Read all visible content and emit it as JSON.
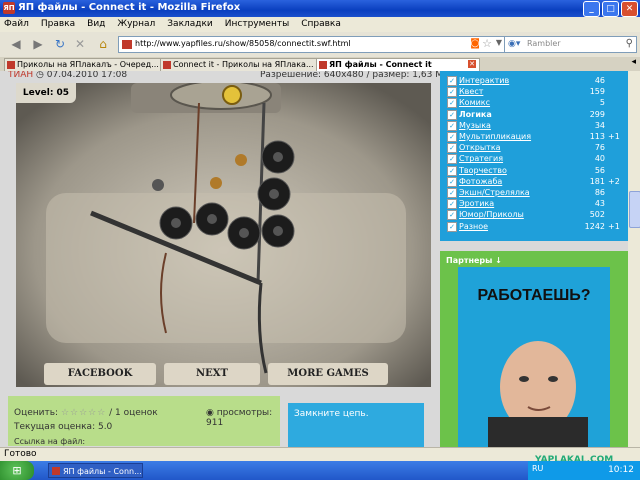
{
  "window": {
    "title": "ЯП файлы - Connect it - Mozilla Firefox"
  },
  "menu": [
    "Файл",
    "Правка",
    "Вид",
    "Журнал",
    "Закладки",
    "Инструменты",
    "Справка"
  ],
  "nav": {
    "url": "http://www.yapfiles.ru/show/85058/connectit.swf.html",
    "search_placeholder": "Rambler"
  },
  "tabs": [
    {
      "label": "Приколы на ЯПлакалъ - Очеред...",
      "active": false
    },
    {
      "label": "Connect it - Приколы на ЯПлака...",
      "active": false
    },
    {
      "label": "ЯП файлы - Connect it",
      "active": true
    }
  ],
  "info": {
    "author": "ТИАН",
    "date": "07.04.2010 17:08",
    "res": "Разрешение: 640x480 / размер: 1,63 Мб"
  },
  "game": {
    "level": "Level: 05",
    "buttons": [
      "FACEBOOK",
      "NEXT",
      "MORE GAMES"
    ]
  },
  "rating": {
    "label": "Оценить:",
    "stars": "☆☆☆☆☆",
    "count": "/ 1 оценок",
    "views": "просмотры: 911",
    "current": "Текущая оценка: 5.0",
    "links": "Ссылка на файл:"
  },
  "tip": "Замкните цепь.",
  "categories": [
    {
      "name": "Интерактив",
      "count": "46",
      "plus": "",
      "bold": false
    },
    {
      "name": "Квест",
      "count": "159",
      "plus": "",
      "bold": false
    },
    {
      "name": "Комикс",
      "count": "5",
      "plus": "",
      "bold": false
    },
    {
      "name": "Логика",
      "count": "299",
      "plus": "",
      "bold": true
    },
    {
      "name": "Музыка",
      "count": "34",
      "plus": "",
      "bold": false
    },
    {
      "name": "Мультипликация",
      "count": "113",
      "plus": "+1",
      "bold": false
    },
    {
      "name": "Открытка",
      "count": "76",
      "plus": "",
      "bold": false
    },
    {
      "name": "Стратегия",
      "count": "40",
      "plus": "",
      "bold": false
    },
    {
      "name": "Творчество",
      "count": "56",
      "plus": "",
      "bold": false
    },
    {
      "name": "Фотожаба",
      "count": "181",
      "plus": "+2",
      "bold": false
    },
    {
      "name": "Экшн/Стрелялка",
      "count": "86",
      "plus": "",
      "bold": false
    },
    {
      "name": "Эротика",
      "count": "43",
      "plus": "",
      "bold": false
    },
    {
      "name": "Юмор/Приколы",
      "count": "502",
      "plus": "",
      "bold": false
    },
    {
      "name": "Разное",
      "count": "1242",
      "plus": "+1",
      "bold": false
    }
  ],
  "partners": {
    "title": "Партнеры ↓",
    "ad_text": "РАБОТАЕШЬ?"
  },
  "status": "Готово",
  "taskbar": {
    "item": "ЯП файлы - Conn...",
    "lang": "RU",
    "clock": "10:12"
  },
  "watermark": "YAPLAKAL.COM"
}
